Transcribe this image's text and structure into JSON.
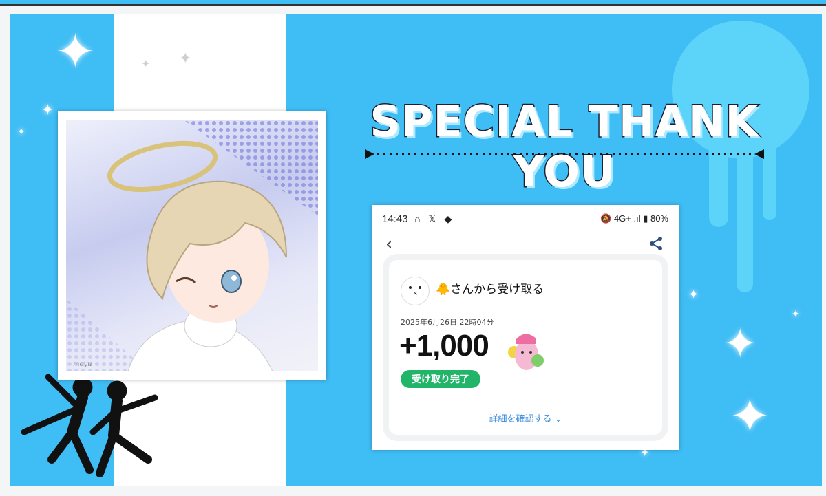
{
  "title": "SPECIAL THANK YOU",
  "artwork": {
    "signature": "moyu"
  },
  "phone": {
    "status_bar": {
      "time": "14:43",
      "left_icons": "⌂ 𝕏 ◆",
      "right_icons": "🔕 4G+ .ıl ▮ 80%"
    },
    "receipt": {
      "sender": "さんから受け取る",
      "datetime": "2025年6月26日 22時04分",
      "amount": "+1,000",
      "status": "受け取り完了",
      "details_link": "詳細を確認する"
    }
  },
  "colors": {
    "background": "#3fbdf5",
    "accent_circle": "#5cd3f8",
    "success": "#22b56a",
    "link": "#3a8ce0"
  },
  "icons": [
    "back-icon",
    "share-icon",
    "chevron-down-icon",
    "sparkle-icon"
  ]
}
